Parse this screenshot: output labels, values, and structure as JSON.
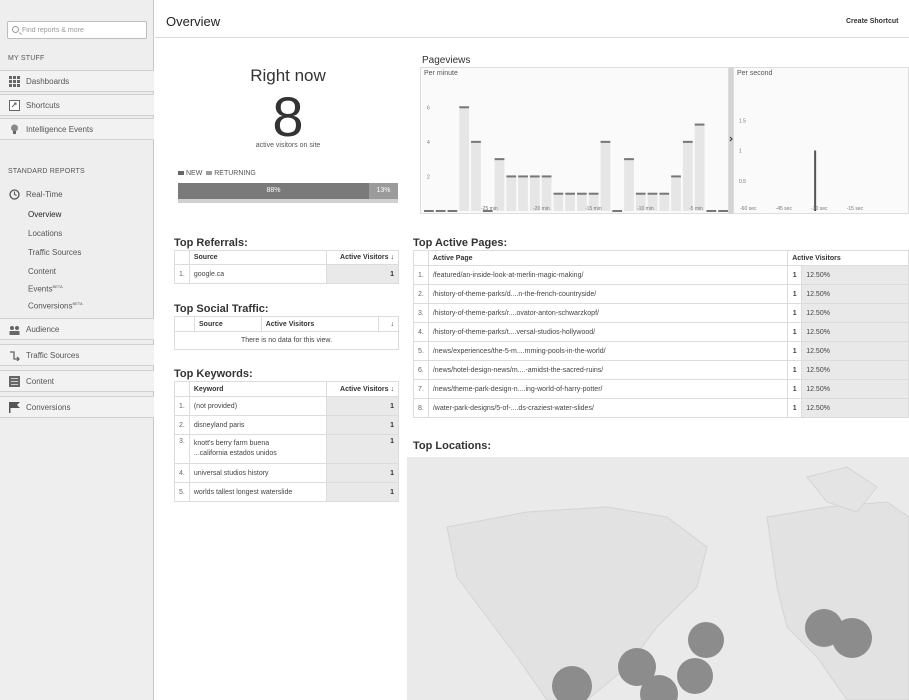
{
  "sidebar": {
    "search_placeholder": "Find reports & more",
    "my_stuff_heading": "MY STUFF",
    "my_stuff": [
      {
        "label": "Dashboards",
        "icon": "dashboards-icon"
      },
      {
        "label": "Shortcuts",
        "icon": "shortcuts-icon"
      },
      {
        "label": "Intelligence Events",
        "icon": "intelligence-events-icon"
      }
    ],
    "standard_heading": "STANDARD REPORTS",
    "realtime": {
      "label": "Real-Time",
      "icon": "clock-icon"
    },
    "realtime_items": [
      {
        "label": "Overview",
        "active": true
      },
      {
        "label": "Locations"
      },
      {
        "label": "Traffic Sources"
      },
      {
        "label": "Content"
      },
      {
        "label": "Events",
        "badge": "BETA"
      },
      {
        "label": "Conversions",
        "badge": "BETA"
      }
    ],
    "reports": [
      {
        "label": "Audience",
        "icon": "audience-icon"
      },
      {
        "label": "Traffic Sources",
        "icon": "traffic-sources-icon"
      },
      {
        "label": "Content",
        "icon": "content-icon"
      },
      {
        "label": "Conversions",
        "icon": "conversions-icon"
      }
    ]
  },
  "header": {
    "title": "Overview",
    "create_shortcut": "Create Shortcut"
  },
  "right_now": {
    "title": "Right now",
    "count": "8",
    "subtitle": "active visitors on site",
    "legend_new": "NEW",
    "legend_returning": "RETURNING",
    "new_pct": "88%",
    "returning_pct": "13%",
    "new_fraction": 0.87
  },
  "pageviews": {
    "title": "Pageviews",
    "per_minute_label": "Per minute",
    "per_second_label": "Per second",
    "pm_y_ticks": [
      "6",
      "4",
      "2"
    ],
    "pm_x_ticks": [
      "-25 min",
      "-20 min",
      "-15 min",
      "-10 min",
      "-5 min"
    ],
    "ps_y_ticks": [
      "1.5",
      "1",
      "0.5"
    ],
    "ps_x_ticks": [
      "-60 sec",
      "-45 sec",
      "-30 sec",
      "-15 sec"
    ],
    "pm_ymax": 7,
    "per_minute_values": [
      0,
      0,
      0,
      6,
      4,
      0,
      3,
      2,
      2,
      2,
      2,
      1,
      1,
      1,
      1,
      4,
      0,
      3,
      1,
      1,
      1,
      2,
      4,
      5,
      0,
      0
    ],
    "ps_ymax": 2,
    "per_second_values": [
      {
        "x": -30,
        "y": 1
      }
    ]
  },
  "top_referrals": {
    "title": "Top Referrals:",
    "headers": {
      "source": "Source",
      "visitors": "Active Visitors"
    },
    "rows": [
      {
        "n": "1.",
        "label": "google.ca",
        "value": "1"
      }
    ]
  },
  "top_social": {
    "title": "Top Social Traffic:",
    "headers": {
      "source": "Source",
      "visitors": "Active Visitors"
    },
    "empty": "There is no data for this view."
  },
  "top_keywords": {
    "title": "Top Keywords:",
    "headers": {
      "keyword": "Keyword",
      "visitors": "Active Visitors"
    },
    "rows": [
      {
        "n": "1.",
        "label": "(not provided)",
        "value": "1"
      },
      {
        "n": "2.",
        "label": "disneyland paris",
        "value": "1"
      },
      {
        "n": "3.",
        "label": "knott's berry farm buena ...california estados unidos",
        "value": "1"
      },
      {
        "n": "4.",
        "label": "universal studios history",
        "value": "1"
      },
      {
        "n": "5.",
        "label": "worlds tallest longest waterslide",
        "value": "1"
      }
    ]
  },
  "top_pages": {
    "title": "Top Active Pages:",
    "headers": {
      "page": "Active Page",
      "visitors": "Active Visitors"
    },
    "rows": [
      {
        "n": "1.",
        "label": "/featured/an-inside-look-at-merlin-magic-making/",
        "count": "1",
        "pct": "12.50%"
      },
      {
        "n": "2.",
        "label": "/history-of-theme-parks/d....n-the-french-countryside/",
        "count": "1",
        "pct": "12.50%"
      },
      {
        "n": "3.",
        "label": "/history-of-theme-parks/r....ovator-anton-schwarzkopf/",
        "count": "1",
        "pct": "12.50%"
      },
      {
        "n": "4.",
        "label": "/history-of-theme-parks/t....versal-studios-hollywood/",
        "count": "1",
        "pct": "12.50%"
      },
      {
        "n": "5.",
        "label": "/news/experiences/the-5-m....mming-pools-in-the-world/",
        "count": "1",
        "pct": "12.50%"
      },
      {
        "n": "6.",
        "label": "/news/hotel-design-news/m....-amidst-the-sacred-ruins/",
        "count": "1",
        "pct": "12.50%"
      },
      {
        "n": "7.",
        "label": "/news/theme-park-design-n....ing-world-of-harry-potter/",
        "count": "1",
        "pct": "12.50%"
      },
      {
        "n": "8.",
        "label": "/water-park-designs/5-of-....ds-craziest-water-slides/",
        "count": "1",
        "pct": "12.50%"
      }
    ]
  },
  "top_locations": {
    "title": "Top Locations:"
  }
}
